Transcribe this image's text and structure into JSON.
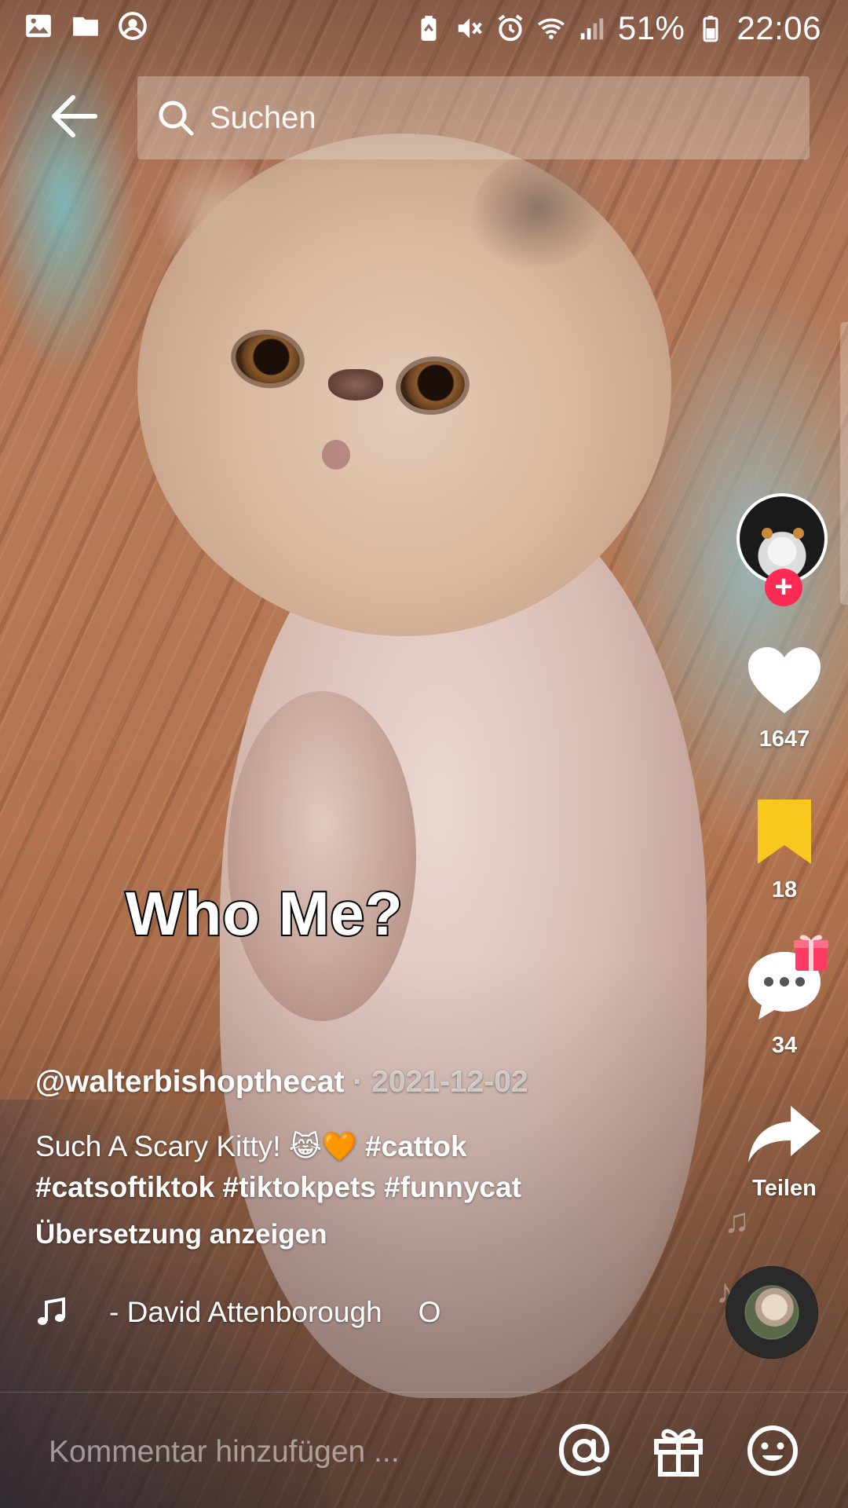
{
  "status_bar": {
    "battery": "51%",
    "time": "22:06",
    "icons": [
      "gallery-icon",
      "folder-icon",
      "account-icon",
      "battery-saver-icon",
      "mute-icon",
      "alarm-icon",
      "wifi-icon",
      "signal-icon",
      "battery-icon"
    ]
  },
  "search": {
    "placeholder": "Suchen"
  },
  "video": {
    "caption": "Who Me?"
  },
  "actions": {
    "likes": "1647",
    "bookmarks": "18",
    "comments": "34",
    "share_label": "Teilen"
  },
  "post": {
    "author": "@walterbishopthecat",
    "separator": "·",
    "date": "2021-12-02",
    "description_text": "Such A Scary Kitty!",
    "emojis": "😹🧡",
    "hashtags": [
      "#cattok",
      "#catsoftiktok",
      "#tiktokpets",
      "#funnycat"
    ],
    "translate_label": "Übersetzung anzeigen",
    "music_title": "- David Attenborough",
    "music_extra": "O"
  },
  "comment_bar": {
    "placeholder": "Kommentar hinzufügen ..."
  },
  "colors": {
    "accent": "#fe2c55",
    "bookmark": "#f9c81e",
    "gift": "#fe3b62"
  }
}
